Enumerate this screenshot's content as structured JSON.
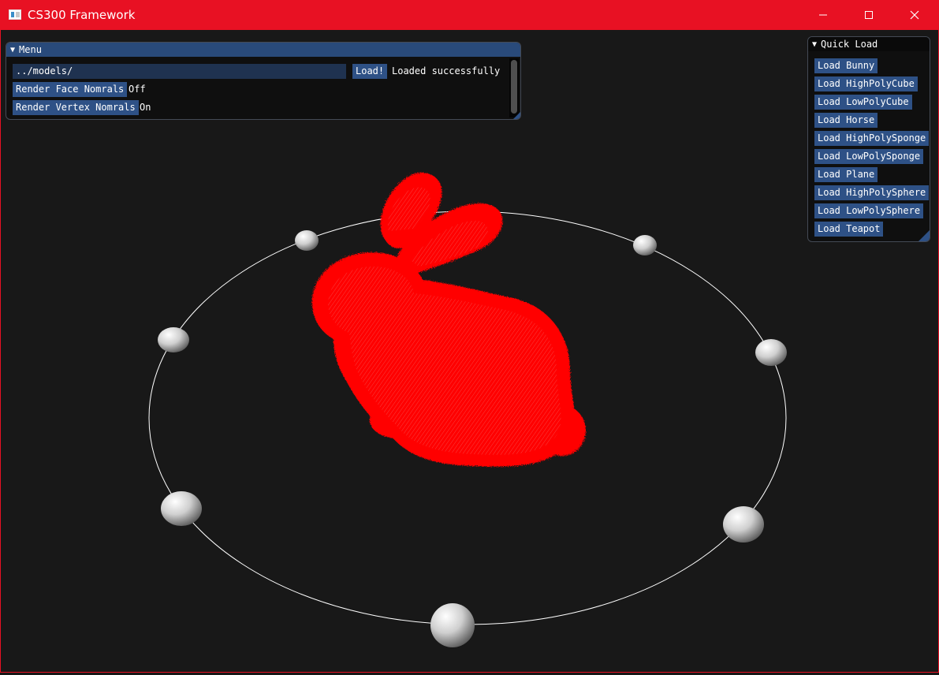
{
  "window": {
    "title": "CS300 Framework"
  },
  "menu_panel": {
    "title": "Menu",
    "path_value": "../models/",
    "load_button": "Load!",
    "status": "Loaded successfully",
    "face_normals_button": "Render Face Nomrals",
    "face_normals_value": "Off",
    "vertex_normals_button": "Render Vertex Nomrals",
    "vertex_normals_value": "On"
  },
  "quick_load_panel": {
    "title": "Quick Load",
    "buttons": [
      "Load Bunny",
      "Load HighPolyCube",
      "Load LowPolyCube",
      "Load Horse",
      "Load HighPolySponge",
      "Load LowPolySponge",
      "Load Plane",
      "Load HighPolySphere",
      "Load LowPolySphere",
      "Load Teapot"
    ]
  },
  "colors": {
    "title_bar": "#e81123",
    "viewport_bg": "#181818",
    "button": "#2e5186",
    "header_active": "#294a7a",
    "normals": "#ff0000"
  }
}
